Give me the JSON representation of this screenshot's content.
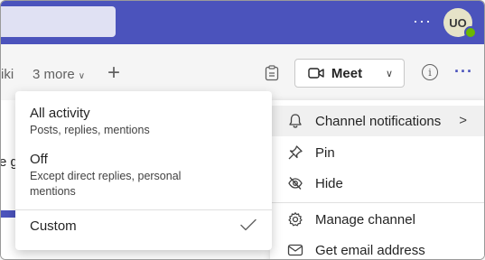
{
  "header": {
    "more_glyph": "···",
    "avatar_initials": "UO"
  },
  "tabs": {
    "wiki_label": "iki",
    "more_label": "3 more",
    "more_chevron": "∨",
    "add_glyph": "+"
  },
  "toolbar": {
    "meet_label": "Meet",
    "meet_chevron": "∨",
    "info_glyph": "i",
    "ellipsis_glyph": "···"
  },
  "background": {
    "partial_text": "e g"
  },
  "notification_options": [
    {
      "title": "All activity",
      "description": "Posts, replies, mentions"
    },
    {
      "title": "Off",
      "description": "Except direct replies, personal mentions"
    },
    {
      "title": "Custom",
      "description": ""
    }
  ],
  "channel_menu": {
    "items": [
      {
        "label": "Channel notifications",
        "icon": "bell-icon"
      },
      {
        "label": "Pin",
        "icon": "pin-icon"
      },
      {
        "label": "Hide",
        "icon": "eye-off-icon"
      },
      {
        "label": "Manage channel",
        "icon": "gear-icon"
      },
      {
        "label": "Get email address",
        "icon": "mail-icon"
      }
    ],
    "submenu_chevron": ">"
  },
  "colors": {
    "brand": "#4b53bc",
    "presence": "#6bb700"
  }
}
